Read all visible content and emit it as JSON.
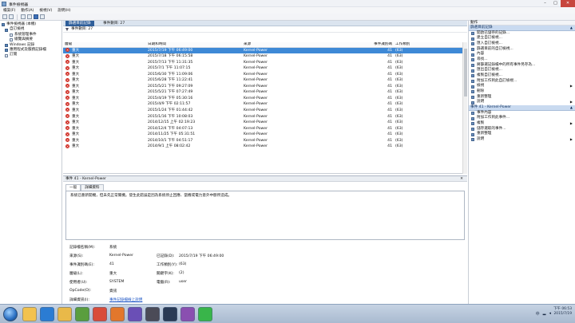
{
  "window": {
    "title": "事件檢視器",
    "minimize": "–",
    "maximize": "□",
    "close": "✕"
  },
  "menu": [
    "檔案(F)",
    "動作(A)",
    "檢視(V)",
    "說明(H)"
  ],
  "tree": [
    {
      "label": "事件檢視器 (本機)",
      "level": 0
    },
    {
      "label": "自訂檢視",
      "level": 1
    },
    {
      "label": "系統管理事件",
      "level": 2
    },
    {
      "label": "總覽與摘要",
      "level": 2
    },
    {
      "label": "Windows 記錄",
      "level": 1
    },
    {
      "label": "應用程式及服務記錄檔",
      "level": 1
    },
    {
      "label": "訂閱",
      "level": 1
    }
  ],
  "center": {
    "header_tab": "篩選目前記錄",
    "header_count": "事件數目: 27",
    "filter_text": "事件數目: 27",
    "columns": [
      "層級",
      "日期和時間",
      "來源",
      "事件識別碼",
      "工作類別"
    ],
    "rows": [
      {
        "level": "重大",
        "datetime": "2015/7/19 下午 06:49:00",
        "source": "Kernel-Power",
        "id": "41",
        "task": "(63)"
      },
      {
        "level": "重大",
        "datetime": "2015/7/18 下午 06:15:58",
        "source": "Kernel-Power",
        "id": "41",
        "task": "(63)"
      },
      {
        "level": "重大",
        "datetime": "2015/7/13 下午 11:31:35",
        "source": "Kernel-Power",
        "id": "41",
        "task": "(63)"
      },
      {
        "level": "重大",
        "datetime": "2015/7/1 下午 11:07:15",
        "source": "Kernel-Power",
        "id": "41",
        "task": "(63)"
      },
      {
        "level": "重大",
        "datetime": "2015/6/30 下午 11:09:06",
        "source": "Kernel-Power",
        "id": "41",
        "task": "(63)"
      },
      {
        "level": "重大",
        "datetime": "2015/6/28 下午 11:22:41",
        "source": "Kernel-Power",
        "id": "41",
        "task": "(63)"
      },
      {
        "level": "重大",
        "datetime": "2015/5/21 下午 09:27:09",
        "source": "Kernel-Power",
        "id": "41",
        "task": "(63)"
      },
      {
        "level": "重大",
        "datetime": "2015/5/21 下午 07:27:49",
        "source": "Kernel-Power",
        "id": "41",
        "task": "(63)"
      },
      {
        "level": "重大",
        "datetime": "2015/4/19 下午 05:30:16",
        "source": "Kernel-Power",
        "id": "41",
        "task": "(63)"
      },
      {
        "level": "重大",
        "datetime": "2015/4/9 下午 02:11:57",
        "source": "Kernel-Power",
        "id": "41",
        "task": "(63)"
      },
      {
        "level": "重大",
        "datetime": "2015/1/24 下午 01:44:42",
        "source": "Kernel-Power",
        "id": "41",
        "task": "(63)"
      },
      {
        "level": "重大",
        "datetime": "2015/1/16 下午 10:08:03",
        "source": "Kernel-Power",
        "id": "41",
        "task": "(63)"
      },
      {
        "level": "重大",
        "datetime": "2014/12/15 上午 02:19:23",
        "source": "Kernel-Power",
        "id": "41",
        "task": "(63)"
      },
      {
        "level": "重大",
        "datetime": "2014/12/4 下午 04:07:13",
        "source": "Kernel-Power",
        "id": "41",
        "task": "(63)"
      },
      {
        "level": "重大",
        "datetime": "2014/11/25 下午 05:31:51",
        "source": "Kernel-Power",
        "id": "41",
        "task": "(63)"
      },
      {
        "level": "重大",
        "datetime": "2014/10/1 下午 04:51:17",
        "source": "Kernel-Power",
        "id": "41",
        "task": "(63)"
      },
      {
        "level": "重大",
        "datetime": "2014/9/1 上午 08:02:42",
        "source": "Kernel-Power",
        "id": "41",
        "task": "(63)"
      }
    ]
  },
  "detail": {
    "title": "事件 41 - Kernel-Power",
    "close": "✕",
    "tabs": [
      "一般",
      "詳細資料"
    ],
    "message": "系統已重新開機，但未先正常關機。發生此錯誤是因為系統停止回應、當機或電力意外中斷所造成。",
    "props": {
      "log_label": "記錄檔名稱(M):",
      "log_value": "系統",
      "source_label": "來源(S):",
      "source_value": "Kernel-Power",
      "logged_label": "已記錄(D):",
      "logged_value": "2015/7/19 下午 06:49:00",
      "eventid_label": "事件識別碼(E):",
      "eventid_value": "41",
      "task_label": "工作類別(Y):",
      "task_value": "(63)",
      "level_label": "層級(L):",
      "level_value": "重大",
      "keywords_label": "關鍵字(K):",
      "keywords_value": "(2)",
      "user_label": "使用者(U):",
      "user_value": "SYSTEM",
      "computer_label": "電腦(R):",
      "computer_value": "user",
      "opcode_label": "OpCode(O):",
      "opcode_value": "資訊",
      "more_label": "詳細資訊(I):",
      "more_value": "事件記錄檔線上說明"
    }
  },
  "actions": {
    "header": "動作",
    "section1": "篩選目前記錄",
    "items1": [
      {
        "label": "開啟已儲存的記錄...",
        "icon": "open-log-icon"
      },
      {
        "label": "建立自訂檢視...",
        "icon": "filter-icon"
      },
      {
        "label": "匯入自訂檢視...",
        "icon": "import-icon"
      },
      {
        "label": "篩選目前的自訂檢視...",
        "icon": "filter-icon"
      },
      {
        "label": "內容",
        "icon": "properties-icon"
      },
      {
        "label": "尋找...",
        "icon": "find-icon"
      },
      {
        "label": "將篩選記錄檔中的所有事件另存為...",
        "icon": "save-icon"
      },
      {
        "label": "匯出自訂檢視...",
        "icon": "export-icon"
      },
      {
        "label": "複製自訂檢視...",
        "icon": "copy-icon"
      },
      {
        "label": "附加工作到此自訂檢視...",
        "icon": "task-icon"
      },
      {
        "label": "檢視",
        "icon": "view-icon",
        "arrow": true
      },
      {
        "label": "刪除",
        "icon": "delete-icon"
      },
      {
        "label": "重新整理",
        "icon": "refresh-icon"
      },
      {
        "label": "說明",
        "icon": "help-icon",
        "arrow": true
      }
    ],
    "section2": "事件 41 - Kernel-Power",
    "items2": [
      {
        "label": "事件內容",
        "icon": "event-properties-icon"
      },
      {
        "label": "附加工作到此事件...",
        "icon": "task-icon"
      },
      {
        "label": "複製",
        "icon": "copy-icon",
        "arrow": true
      },
      {
        "label": "儲存選取的事件...",
        "icon": "save-icon"
      },
      {
        "label": "重新整理",
        "icon": "refresh-icon"
      },
      {
        "label": "說明",
        "icon": "help-icon",
        "arrow": true
      }
    ]
  },
  "taskbar": {
    "apps": [
      "explorer-icon",
      "ie-icon",
      "folder-icon",
      "media-icon",
      "chrome-icon",
      "firefox-icon",
      "vs-icon",
      "app-icon",
      "steam-icon",
      "app2-icon",
      "line-icon"
    ],
    "ime": "中",
    "time": "下午 06:53",
    "date": "2015/7/19"
  }
}
